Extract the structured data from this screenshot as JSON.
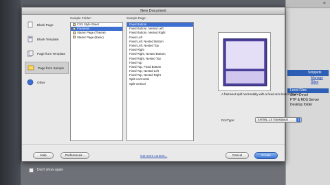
{
  "dialog": {
    "title": "New Document",
    "categories": [
      {
        "label": "Blank Page",
        "icon": "blank-page-icon",
        "selected": false
      },
      {
        "label": "Blank Template",
        "icon": "blank-template-icon",
        "selected": false
      },
      {
        "label": "Page from Template",
        "icon": "page-from-template-icon",
        "selected": false
      },
      {
        "label": "Page from Sample",
        "icon": "page-from-sample-icon",
        "selected": true
      },
      {
        "label": "Other",
        "icon": "other-icon",
        "selected": false
      }
    ],
    "sample_folder": {
      "label": "Sample Folder:",
      "items": [
        {
          "label": "CSS Style Sheet",
          "selected": false
        },
        {
          "label": "Frameset",
          "selected": true
        },
        {
          "label": "Starter Page (Theme)",
          "selected": false
        },
        {
          "label": "Starter Page (Basic)",
          "selected": false
        }
      ]
    },
    "sample_page": {
      "label": "Sample Page:",
      "items": [
        {
          "label": "Fixed Bottom",
          "selected": true
        },
        {
          "label": "Fixed Bottom, Nested Left",
          "selected": false
        },
        {
          "label": "Fixed Bottom, Nested Right",
          "selected": false
        },
        {
          "label": "Fixed Left",
          "selected": false
        },
        {
          "label": "Fixed Left, Nested Bottom",
          "selected": false
        },
        {
          "label": "Fixed Left, Nested Top",
          "selected": false
        },
        {
          "label": "Fixed Right",
          "selected": false
        },
        {
          "label": "Fixed Right, Nested Bottom",
          "selected": false
        },
        {
          "label": "Fixed Right, Nested Top",
          "selected": false
        },
        {
          "label": "Fixed Top",
          "selected": false
        },
        {
          "label": "Fixed Top, Fixed Bottom",
          "selected": false
        },
        {
          "label": "Fixed Top, Nested Left",
          "selected": false
        },
        {
          "label": "Fixed Top, Nested Right",
          "selected": false
        },
        {
          "label": "Split Horizontal",
          "selected": false
        },
        {
          "label": "Split Vertical",
          "selected": false
        }
      ]
    },
    "preview": {
      "description": "A frameset split horizontally with a fixed-size bottom frame.",
      "doctype_label": "DocType:",
      "doctype_value": "XHTML 1.0 Transitional"
    },
    "buttons": {
      "help": "Help",
      "preferences": "Preferences...",
      "get_more": "Get more content...",
      "cancel": "Cancel",
      "create": "Create"
    }
  },
  "background": {
    "checkbox_label": "Don't show again",
    "panel_tab_label": "Snippets",
    "panel_link": "Manage Sites",
    "tree_items": [
      "Local Files",
      "Site - Devel",
      "FTP & RDS Server",
      "Desktop folder"
    ]
  },
  "colors": {
    "selection": "#3d6fd1",
    "preview_purple": "#5b4aa8",
    "preview_light": "#d9d2f2"
  }
}
